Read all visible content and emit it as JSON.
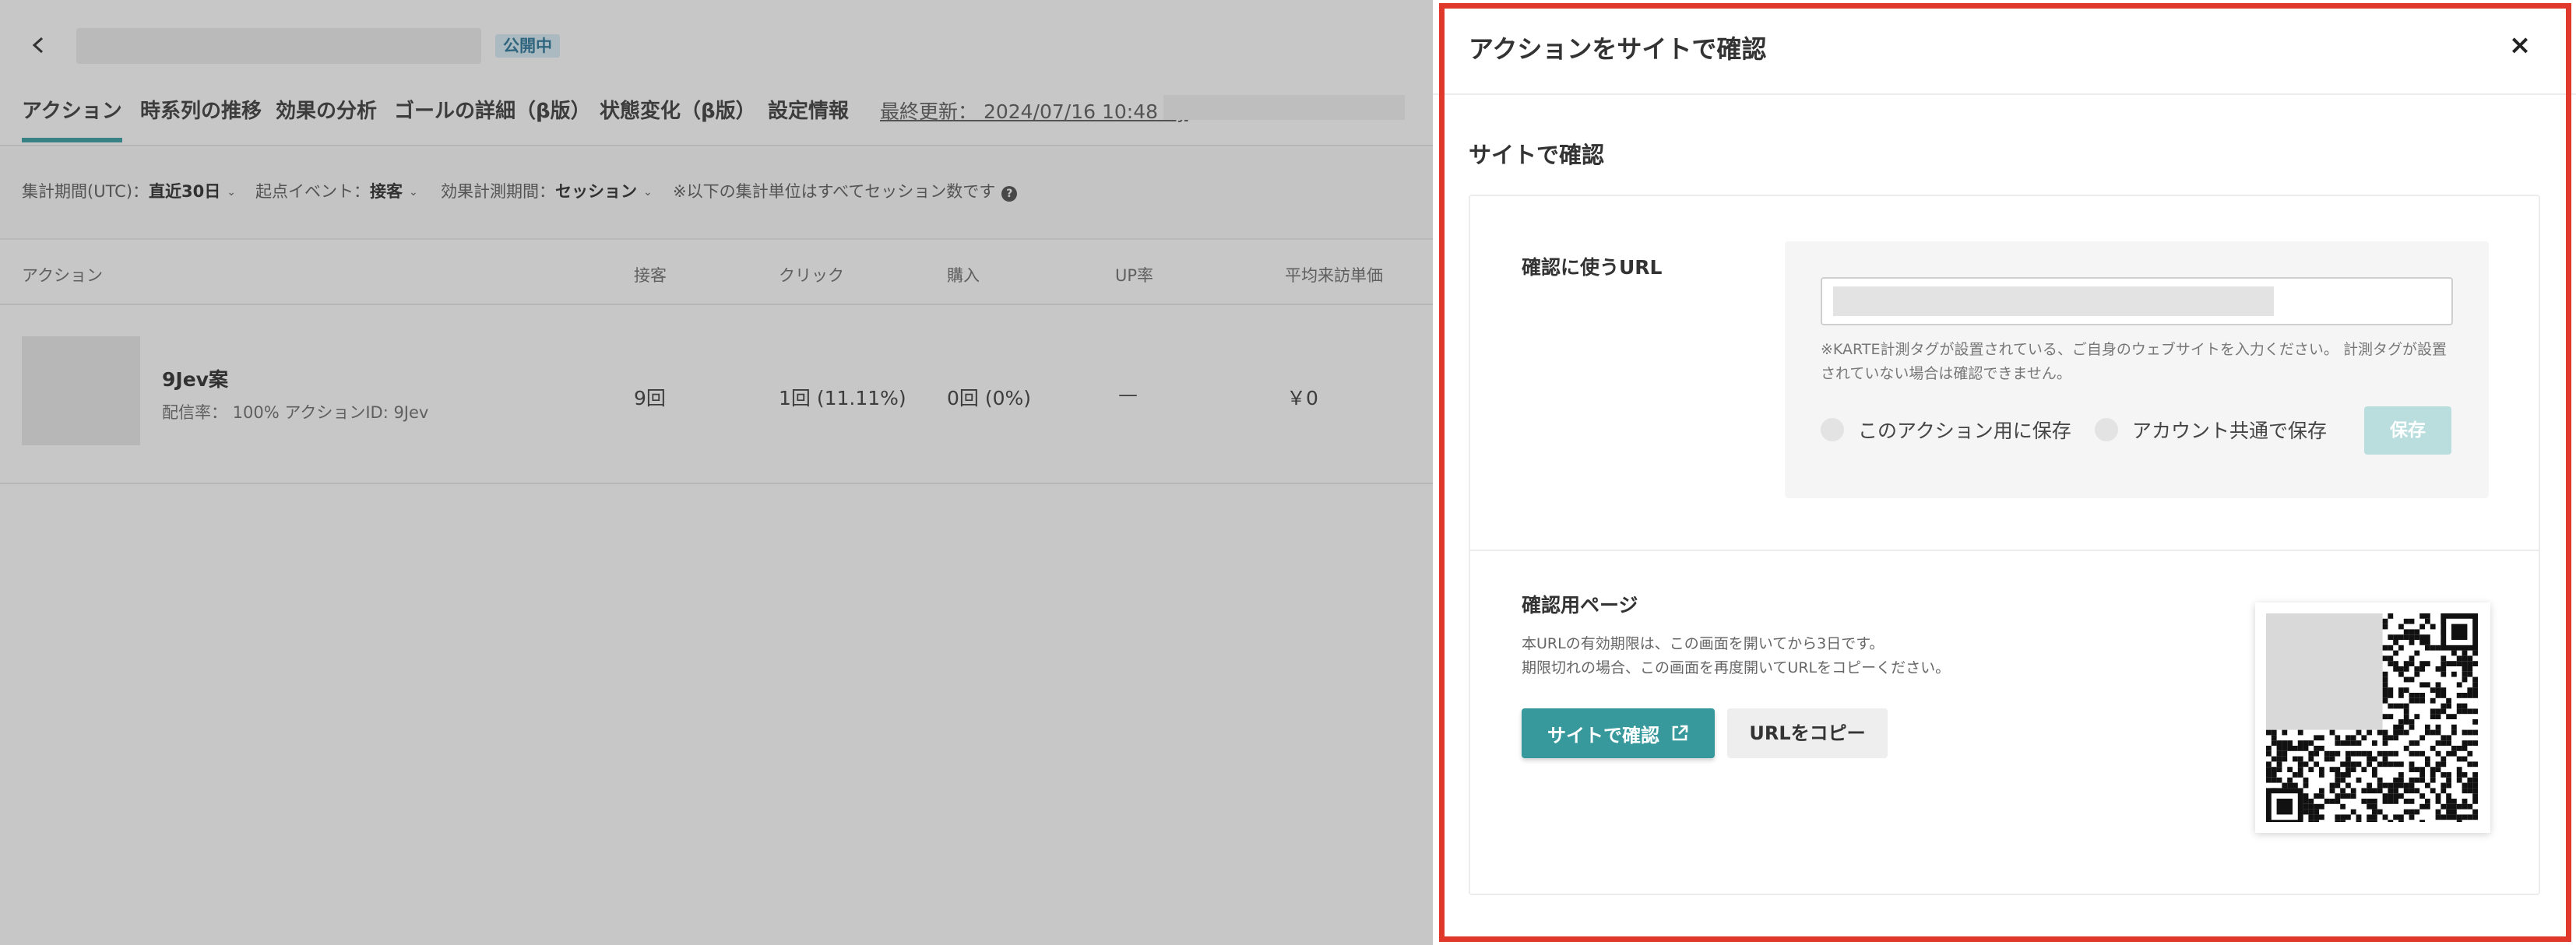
{
  "page": {
    "status_badge": "公開中",
    "tabs": [
      {
        "label": "アクション",
        "active": true
      },
      {
        "label": "時系列の推移",
        "active": false
      },
      {
        "label": "効果の分析",
        "active": false
      },
      {
        "label": "ゴールの詳細（β版）",
        "active": false
      },
      {
        "label": "状態変化（β版）",
        "active": false
      },
      {
        "label": "設定情報",
        "active": false
      }
    ],
    "last_updated": "最終更新： 2024/07/16 10:48 by",
    "filters": [
      {
        "label": "集計期間(UTC)：",
        "value": "直近30日"
      },
      {
        "label": "起点イベント：",
        "value": "接客"
      },
      {
        "label": "効果計測期間：",
        "value": "セッション"
      }
    ],
    "filter_note": "※以下の集計単位はすべてセッション数です",
    "table": {
      "headers": [
        "アクション",
        "接客",
        "クリック",
        "購入",
        "UP率",
        "平均来訪単価"
      ],
      "rows": [
        {
          "name": "9Jev案",
          "meta": "配信率： 100% アクションID: 9Jev",
          "cells": [
            "9回",
            "1回 (11.11%)",
            "0回 (0%)",
            "—",
            "￥0"
          ]
        }
      ]
    }
  },
  "drawer": {
    "title": "アクションをサイトで確認",
    "close_icon": "×",
    "section_title": "サイトで確認",
    "url_label": "確認に使うURL",
    "url_value": "",
    "url_note": "※KARTE計測タグが設置されている、ご自身のウェブサイトを入力ください。 計測タグが設置されていない場合は確認できません。",
    "radio_this_action": "このアクション用に保存",
    "radio_account": "アカウント共通で保存",
    "save_label": "保存",
    "confirm_page_label": "確認用ページ",
    "confirm_note_1": "本URLの有効期限は、この画面を開いてから3日です。",
    "confirm_note_2": "期限切れの場合、この画面を再度開いてURLをコピーください。",
    "site_button_label": "サイトで確認",
    "copy_button_label": "URLをコピー"
  },
  "colors": {
    "accent": "#37999c",
    "highlight_border": "#e0382b",
    "badge_bg": "#d6ecf6"
  },
  "icons": [
    "back-icon",
    "chevron-down-icon",
    "help-icon",
    "close-icon",
    "external-link-icon",
    "qr-code"
  ]
}
